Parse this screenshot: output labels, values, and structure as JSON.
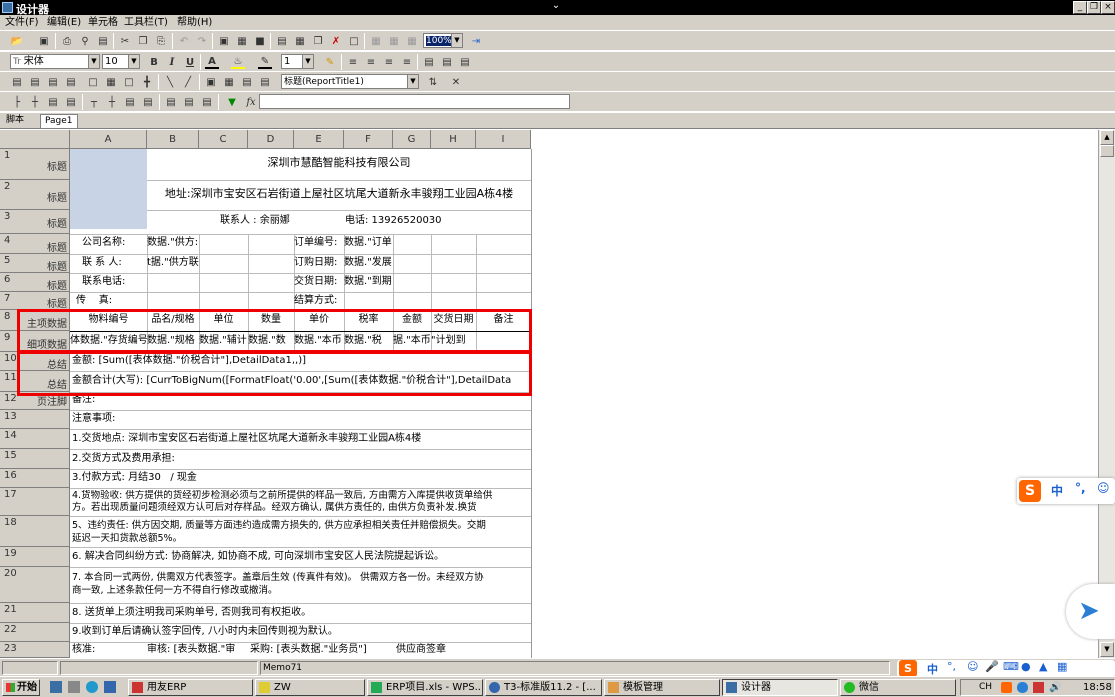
{
  "window": {
    "title": "设计器"
  },
  "menu": [
    "文件(F)",
    "编辑(E)",
    "单元格",
    "工具栏(T)",
    "帮助(H)"
  ],
  "toolbar2": {
    "font": "宋体",
    "size": "10",
    "line_width": "1",
    "zoom": "100%",
    "style": "标题(ReportTitle1)"
  },
  "toolbar3": {
    "fx_label": "fx",
    "formula": ""
  },
  "tabs": [
    "脚本",
    "Page1"
  ],
  "columns": [
    "A",
    "B",
    "C",
    "D",
    "E",
    "F",
    "G",
    "H",
    "I"
  ],
  "rows": [
    {
      "n": "1",
      "label": "标题"
    },
    {
      "n": "2",
      "label": "标题"
    },
    {
      "n": "3",
      "label": "标题"
    },
    {
      "n": "4",
      "label": "标题"
    },
    {
      "n": "5",
      "label": "标题"
    },
    {
      "n": "6",
      "label": "标题"
    },
    {
      "n": "7",
      "label": "标题"
    },
    {
      "n": "8",
      "label": "主项数据"
    },
    {
      "n": "9",
      "label": "细项数据"
    },
    {
      "n": "10",
      "label": "总结"
    },
    {
      "n": "11",
      "label": "总结"
    },
    {
      "n": "12",
      "label": "页注脚"
    },
    {
      "n": "13",
      "label": ""
    },
    {
      "n": "14",
      "label": ""
    },
    {
      "n": "15",
      "label": ""
    },
    {
      "n": "16",
      "label": ""
    },
    {
      "n": "17",
      "label": ""
    },
    {
      "n": "18",
      "label": ""
    },
    {
      "n": "19",
      "label": ""
    },
    {
      "n": "20",
      "label": ""
    },
    {
      "n": "21",
      "label": ""
    },
    {
      "n": "22",
      "label": ""
    },
    {
      "n": "23",
      "label": ""
    }
  ],
  "cells": {
    "company": "深圳市慧酷智能科技有限公司",
    "address": "地址:深圳市宝安区石岩街道上屋社区坑尾大道新永丰骏翔工业园A栋4楼",
    "contact": "联系人 : 余丽娜",
    "phone": "电话: 13926520030",
    "r4a": "公司名称:",
    "r4b": "数据.\"供方:",
    "r4e": "订单编号:",
    "r4f": "数据.\"订单",
    "r5a": "联 系 人:",
    "r5b": "t据.\"供方联",
    "r5e": "订购日期:",
    "r5f": "数据.\"发展",
    "r6a": "联系电话:",
    "r6e": "交货日期:",
    "r6f": "数据.\"到期",
    "r7a": "传    真:",
    "r7e": "结算方式:",
    "headers": [
      "物料编号",
      "品名/规格",
      "单位",
      "数量",
      "单价",
      "税率",
      "金额",
      "交货日期",
      "备注"
    ],
    "details": [
      "体数据.\"存货编号",
      "数据.\"规格",
      "数据.\"辅计",
      "数据.\"数",
      "数据.\"本币",
      "数据.\"税",
      "据.\"本币",
      "\"计划到"
    ],
    "r10": "金额: [Sum([表体数据.\"价税合计\"],DetailData1,,)]",
    "r11": "金额合计(大写): [CurrToBigNum([FormatFloat('0.00',[Sum([表体数据.\"价税合计\"],DetailData",
    "r12": "备注:",
    "r13": "注意事项:",
    "r14": "1.交货地点: 深圳市宝安区石岩街道上屋社区坑尾大道新永丰骏翔工业园A栋4楼",
    "r15": "2.交货方式及费用承担:",
    "r16": "3.付款方式: 月结30   / 现金",
    "r17a": "4.货物验收: 供方提供的货经初步检测必须与之前所提供的样品一致后, 方由需方入库提供收货单给供",
    "r17b": "方。若出现质量问题须经双方认可后对存样品。经双方确认, 属供方责任的, 由供方负责补发.换货",
    "r18a": "5、违约责任: 供方因交期, 质量等方面违约造成需方损失的, 供方应承担相关责任并赔偿损失。交期",
    "r18b": "延迟一天扣货款总额5%。",
    "r19": "6. 解决合同纠纷方式: 协商解决, 如协商不成, 可向深圳市宝安区人民法院提起诉讼。",
    "r20a": "7. 本合同一式两份, 供需双方代表签字。盖章后生效 (传真件有效)。 供需双方各一份。未经双方协",
    "r20b": "商一致, 上述条款任何一方不得自行修改或撤消。",
    "r21": "8. 送货单上须注明我司采购单号, 否则我司有权拒收。",
    "r22": "9.收到订单后请确认签字回传, 八小时内未回传则视为默认。",
    "r23a": "核准:",
    "r23b": "审核: [表头数据.\"审",
    "r23c": "采购: [表头数据.\"业务员\"]",
    "r23d": "供应商签章"
  },
  "status": {
    "memo": "Memo71"
  },
  "taskbar": {
    "start": "开始",
    "items": [
      "用友ERP",
      "ZW",
      "ERP项目.xls - WPS...",
      "T3-标准版11.2 - [...",
      "模板管理",
      "设计器",
      "微信"
    ],
    "lang": "CH",
    "time": "18:58"
  },
  "ime": {
    "label": "中"
  }
}
